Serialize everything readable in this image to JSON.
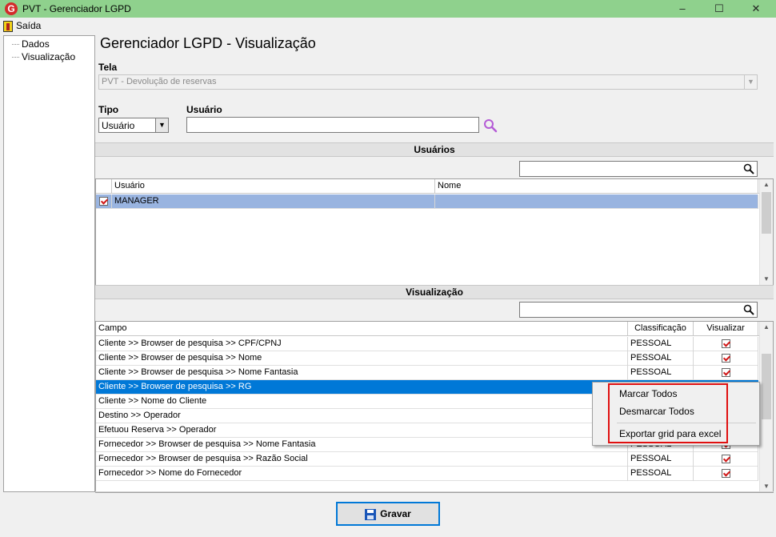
{
  "window": {
    "app_icon_letter": "G",
    "title": "PVT - Gerenciador LGPD",
    "minimize_label": "–",
    "maximize_label": "☐",
    "close_label": "✕"
  },
  "menu": {
    "exit_label": "Saída"
  },
  "tree": {
    "items": [
      "Dados",
      "Visualização"
    ]
  },
  "main": {
    "page_title": "Gerenciador LGPD - Visualização",
    "tela_label": "Tela",
    "tela_value": "PVT - Devolução de reservas",
    "tipo_label": "Tipo",
    "tipo_value": "Usuário",
    "usuario_label": "Usuário",
    "usuario_value": ""
  },
  "users_section": {
    "title": "Usuários",
    "search_value": "",
    "columns": [
      "Usuário",
      "Nome"
    ],
    "rows": [
      {
        "checked": true,
        "usuario": "MANAGER",
        "nome": ""
      }
    ]
  },
  "visual_section": {
    "title": "Visualização",
    "search_value": "",
    "columns": [
      "Campo",
      "Classificação",
      "Visualizar"
    ],
    "rows": [
      {
        "campo": "Cliente >> Browser de pesquisa >> CPF/CPNJ",
        "classificacao": "PESSOAL",
        "visualizar": true
      },
      {
        "campo": "Cliente >> Browser de pesquisa >> Nome",
        "classificacao": "PESSOAL",
        "visualizar": true
      },
      {
        "campo": "Cliente >> Browser de pesquisa >> Nome Fantasia",
        "classificacao": "PESSOAL",
        "visualizar": true
      },
      {
        "campo": "Cliente >> Browser de pesquisa >> RG",
        "classificacao": "",
        "visualizar": null
      },
      {
        "campo": "Cliente >> Nome do Cliente",
        "classificacao": "",
        "visualizar": null
      },
      {
        "campo": "Destino >> Operador",
        "classificacao": "",
        "visualizar": null
      },
      {
        "campo": "Efetuou Reserva >> Operador",
        "classificacao": "",
        "visualizar": null
      },
      {
        "campo": "Fornecedor >> Browser de pesquisa >> Nome Fantasia",
        "classificacao": "PESSOAL",
        "visualizar": true
      },
      {
        "campo": "Fornecedor >> Browser de pesquisa >> Razão Social",
        "classificacao": "PESSOAL",
        "visualizar": true
      },
      {
        "campo": "Fornecedor >> Nome do Fornecedor",
        "classificacao": "PESSOAL",
        "visualizar": true
      }
    ]
  },
  "context_menu": {
    "items": [
      "Marcar Todos",
      "Desmarcar Todos",
      "Exportar grid para excel"
    ]
  },
  "footer": {
    "save_label": "Gravar"
  },
  "colors": {
    "titlebar": "#8fd18d",
    "selection": "#0078d7",
    "checked_row": "#99b4e0",
    "highlight": "#e01010",
    "check_mark": "#d01818"
  }
}
